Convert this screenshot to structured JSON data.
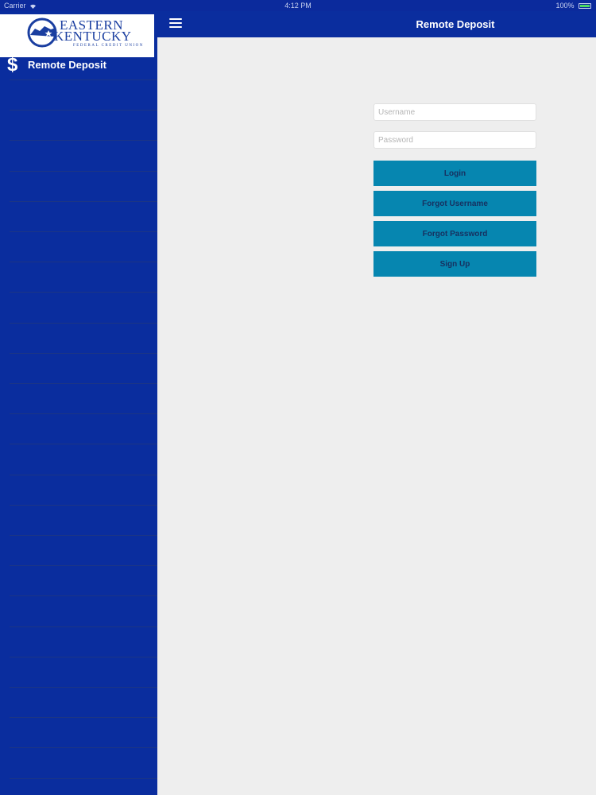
{
  "status_bar": {
    "carrier": "Carrier",
    "time": "4:12 PM",
    "battery": "100%"
  },
  "sidebar": {
    "logo": {
      "line1": "EASTERN",
      "line2": "KENTUCKY",
      "line3": "FEDERAL CREDIT UNION"
    },
    "items": [
      {
        "icon": "dollar-icon",
        "label": "Remote Deposit"
      }
    ]
  },
  "header": {
    "title": "Remote Deposit",
    "menu_icon": "hamburger-icon"
  },
  "login_form": {
    "username_placeholder": "Username",
    "password_placeholder": "Password",
    "login_label": "Login",
    "forgot_username_label": "Forgot Username",
    "forgot_password_label": "Forgot Password",
    "signup_label": "Sign Up"
  },
  "colors": {
    "brand_blue": "#0a2d9e",
    "button_teal": "#0686b0",
    "background": "#eeeeee"
  }
}
